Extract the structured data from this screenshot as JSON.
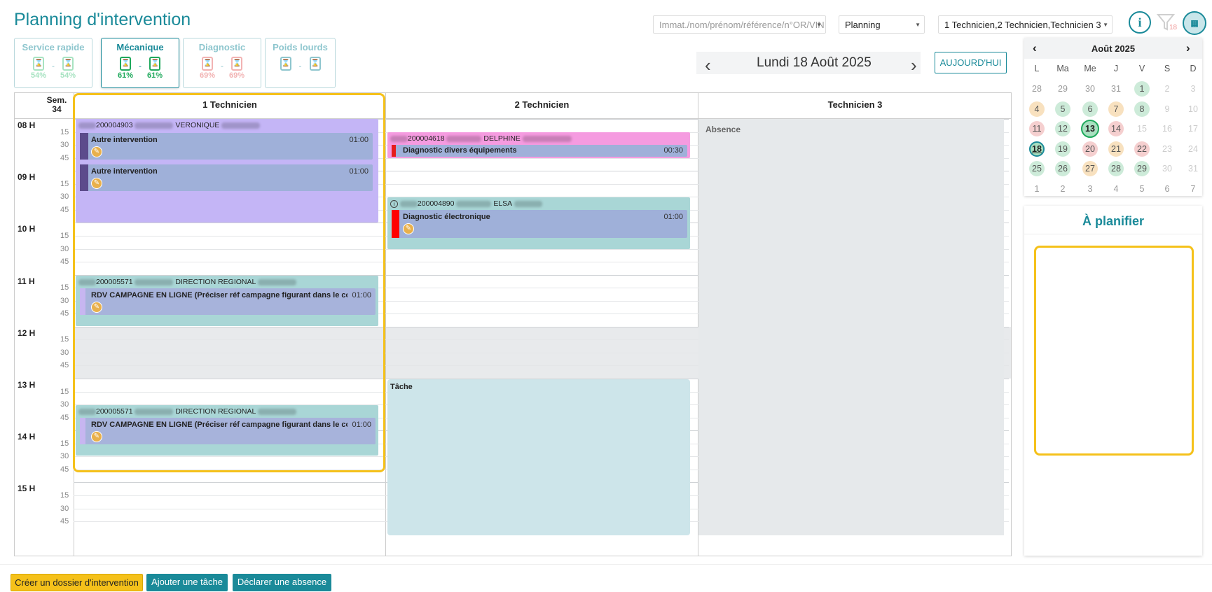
{
  "page": {
    "title": "Planning d'intervention"
  },
  "categories": [
    {
      "label": "Service rapide",
      "pct_left": "54%",
      "pct_right": "54%",
      "color": "#a8e3c2"
    },
    {
      "label": "Mécanique",
      "pct_left": "61%",
      "pct_right": "61%",
      "color": "#1fa95c"
    },
    {
      "label": "Diagnostic",
      "pct_left": "69%",
      "pct_right": "69%",
      "color": "#f2b3b3"
    },
    {
      "label": "Poids lourds",
      "pct_left": "",
      "pct_right": "",
      "color": "#8ec6ce"
    }
  ],
  "toolbar": {
    "search_placeholder": "Immat./nom/prénom/référence/n°OR/VIN",
    "view_select": "Planning",
    "tech_select": "1 Technicien,2 Technicien,Technicien 3",
    "info_icon_text": "i",
    "filter_badge": "18"
  },
  "date_nav": {
    "date": "Lundi 18 Août 2025",
    "today_label": "AUJOURD'HUI"
  },
  "grid": {
    "week_label": "Sem.",
    "week_num": "34",
    "columns": [
      "1 Technicien",
      "2 Technicien",
      "Technicien 3"
    ],
    "hours": [
      "08 H",
      "09 H",
      "10 H",
      "11 H",
      "12 H",
      "13 H",
      "14 H",
      "15 H"
    ],
    "minutes": [
      "15",
      "30",
      "45"
    ]
  },
  "events": {
    "e1": {
      "ref": "200004903",
      "name": "VERONIQUE",
      "task1": "Autre intervention",
      "dur1": "01:00",
      "task2": "Autre intervention",
      "dur2": "01:00"
    },
    "e2": {
      "ref": "200005571",
      "name": "DIRECTION REGIONAL",
      "task": "RDV CAMPAGNE EN LIGNE (Préciser réf campagne figurant dans le cou...",
      "dur": "01:00"
    },
    "e3": {
      "ref": "200005571",
      "name": "DIRECTION REGIONAL",
      "task": "RDV CAMPAGNE EN LIGNE (Préciser réf campagne figurant dans le cou...",
      "dur": "01:00"
    },
    "e4": {
      "ref": "200004618",
      "name": "DELPHINE",
      "task": "Diagnostic divers équipements",
      "dur": "00:30"
    },
    "e5": {
      "ref": "200004890",
      "name": "ELSA",
      "task": "Diagnostic électronique",
      "dur": "01:00"
    },
    "e6": {
      "label": "Tâche"
    },
    "absence": {
      "label": "Absence"
    }
  },
  "mini_calendar": {
    "month": "Août 2025",
    "dow": [
      "L",
      "Ma",
      "Me",
      "J",
      "V",
      "S",
      "D"
    ],
    "weeks": [
      [
        "28",
        "29",
        "30",
        "31",
        "1",
        "2",
        "3"
      ],
      [
        "4",
        "5",
        "6",
        "7",
        "8",
        "9",
        "10"
      ],
      [
        "11",
        "12",
        "13",
        "14",
        "15",
        "16",
        "17"
      ],
      [
        "18",
        "19",
        "20",
        "21",
        "22",
        "23",
        "24"
      ],
      [
        "25",
        "26",
        "27",
        "28",
        "29",
        "30",
        "31"
      ],
      [
        "1",
        "2",
        "3",
        "4",
        "5",
        "6",
        "7"
      ]
    ]
  },
  "to_plan": {
    "title": "À planifier"
  },
  "footer": {
    "create_label": "Créer un dossier d'intervention",
    "add_task_label": "Ajouter une tâche",
    "absence_label": "Déclarer une absence"
  },
  "colors": {
    "accent": "#1a8a99",
    "highlight": "#f5c11a",
    "purple_event": "#c4b5f6",
    "teal_event": "#a9d6d6",
    "pink_event": "#f59be0"
  }
}
